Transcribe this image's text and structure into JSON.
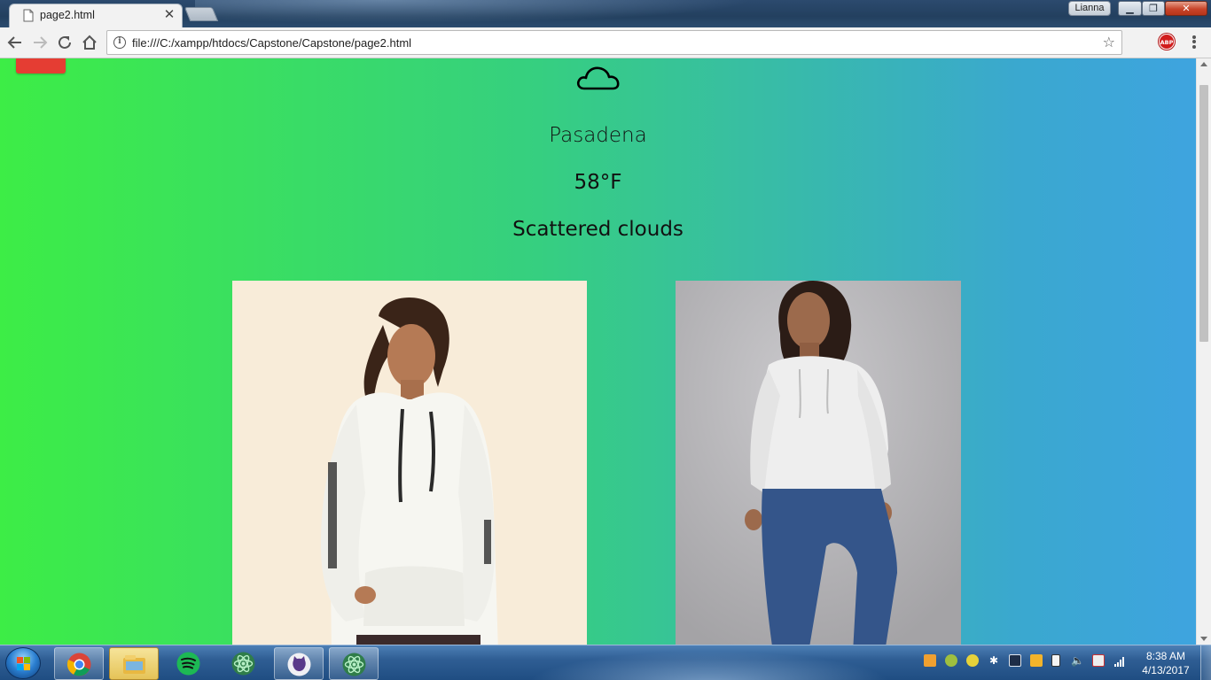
{
  "browser": {
    "tab_title": "page2.html",
    "profile_name": "Lianna",
    "url": "file:///C:/xampp/htdocs/Capstone/Capstone/page2.html",
    "extension_label": "ABP"
  },
  "weather": {
    "icon": "cloud-icon",
    "city": "Pasadena",
    "temperature": "58°F",
    "description": "Scattered clouds"
  },
  "products": [
    {
      "kind": "white hoodie with sleeve print",
      "background": "#f8ecd9"
    },
    {
      "kind": "white satin hoodie with blue jeans",
      "background": "#b0afb2"
    }
  ],
  "taskbar": {
    "apps": [
      "chrome-icon",
      "file-explorer-icon",
      "spotify-icon",
      "atom-icon",
      "github-desktop-icon",
      "atom-icon"
    ],
    "time": "8:38 AM",
    "date": "4/13/2017"
  },
  "colors": {
    "gradient_start": "#3ded46",
    "gradient_end": "#3ea4df",
    "accent_red": "#e53d33"
  }
}
